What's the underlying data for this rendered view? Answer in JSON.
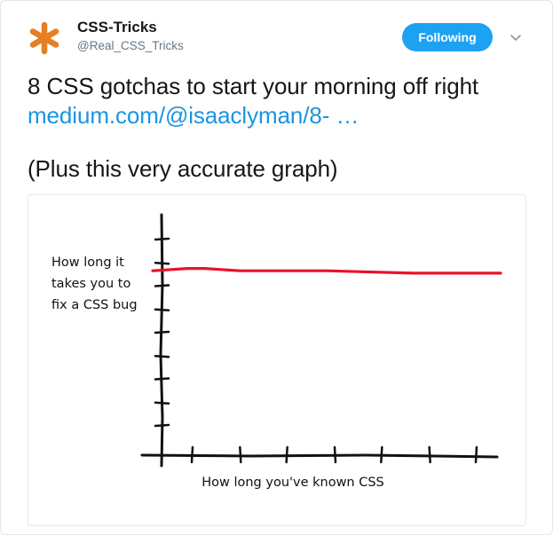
{
  "account": {
    "name": "CSS-Tricks",
    "handle": "@Real_CSS_Tricks",
    "avatar_icon": "asterisk-icon",
    "avatar_color": "#e67e22"
  },
  "follow_button": {
    "label": "Following",
    "color": "#1da1f2"
  },
  "menu_caret": {
    "icon": "chevron-down-icon"
  },
  "tweet": {
    "line1": "8 CSS gotchas to start your morning off right",
    "link_text": "medium.com/@isaaclyman/8-  …",
    "line3": "(Plus this very accurate graph)",
    "link_color": "#1b95e0"
  },
  "chart_data": {
    "type": "line",
    "title": "",
    "xlabel": "How long you've known CSS",
    "ylabel": "How long it takes you to fix a CSS bug",
    "ylabel_lines": [
      "How long it",
      "takes you to",
      "fix a CSS bug"
    ],
    "x": [
      0,
      0.1,
      0.15,
      0.25,
      0.5,
      0.75,
      1.0
    ],
    "series": [
      {
        "values": [
          0.79,
          0.8,
          0.8,
          0.79,
          0.79,
          0.78,
          0.78
        ],
        "color": "#e8122b"
      }
    ],
    "xlim": [
      0,
      1
    ],
    "ylim": [
      0,
      1
    ],
    "x_ticks": 7,
    "y_ticks": 9,
    "grid": false,
    "style": "hand-drawn"
  }
}
